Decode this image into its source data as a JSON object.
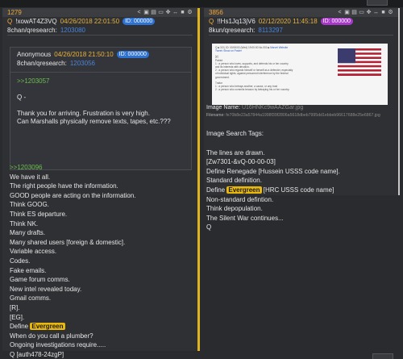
{
  "left_post": {
    "number": "1279",
    "q_mark": "Q",
    "tripcode": "!xowAT4Z3VQ",
    "date": "04/26/2018 22:01:50",
    "id_pill": "ID: 000000",
    "board": "8chan/qresearch:",
    "post_id": "1203080",
    "quote": {
      "author": "Anonymous",
      "date": "04/26/2018 21:50:10",
      "id_pill": "ID: 000000",
      "board": "8chan/qresearch:",
      "post_id": "1203056",
      "greentext": ">>1203057",
      "text": [
        "Q -",
        "",
        "Thank you for arriving.  Frustration is very high.",
        "Can Marshalls physically remove texts, tapes, etc.???"
      ]
    },
    "greentext": ">>1203096",
    "body_before": [
      "We have it all.",
      "The right people have the information.",
      "GOOD people are acting on the information.",
      "Think GOOG.",
      "Think ES departure.",
      "Think NK.",
      "Many drafts.",
      "Many shared users [foreign & domestic].",
      "Variable access.",
      "Codes.",
      "Fake emails.",
      "Game forum comms.",
      "New intel revealed today.",
      "Gmail comms.",
      "[R].",
      "[EG]."
    ],
    "define_prefix": "Define",
    "highlight": "Evergreen",
    "body_after": [
      "When do you call a plumber?",
      "Ongoing investigations require.....",
      "Q [auth478-24zgP]"
    ]
  },
  "right_post": {
    "number": "3856",
    "q_mark": "Q",
    "tripcode": "!!Hs1Jq13jV6",
    "date": "02/12/2020 11:45:18",
    "id_pill": "ID: 000000",
    "board": "8kun/qresearch:",
    "post_id": "8113297",
    "image_text": {
      "header": "Q ■ 3/3 |  ID:  00/00/00 (Wed) 19:00:00 No.000 ■",
      "link": "Marvel Website",
      "link2": "Tweet: Show on Poster",
      "sections": [
        "[p]",
        "Patriot",
        "1 : a person who loves, supports, and defends his or her country",
        "and its interests with devotion.",
        "2 : a person who regards himself or herself as a defender, especially",
        "of individual rights, against presumed interference by the federal",
        "government.",
        "",
        "Traitor",
        "1 : a person who betrays another, a cause, or any trust",
        "2 : a person who commits treason by betraying his or her country."
      ]
    },
    "image_name_label": "Image Name:",
    "image_name": "U16HNKc9wAAZGar.jpg",
    "filename_label": "Filename:",
    "filename": "fe70b8e23a57844a1998f39f2806a5618dbeb7995dd1ebbeb96617688e25e6867.jpg",
    "image_tags": "Image Search Tags:",
    "lines_before": [
      "The lines are drawn.",
      "[Zw7301-&vQ-00-00-03]",
      "Define Renegade [Hussein USSS code name].",
      "Standard definition."
    ],
    "define_prefix": "Define",
    "highlight": "Evergreen",
    "define_suffix": "[HRC USSS code name]",
    "lines_after": [
      "Non-standard defintion.",
      "Think depopulation.",
      "The Silent War continues...",
      "Q"
    ]
  }
}
